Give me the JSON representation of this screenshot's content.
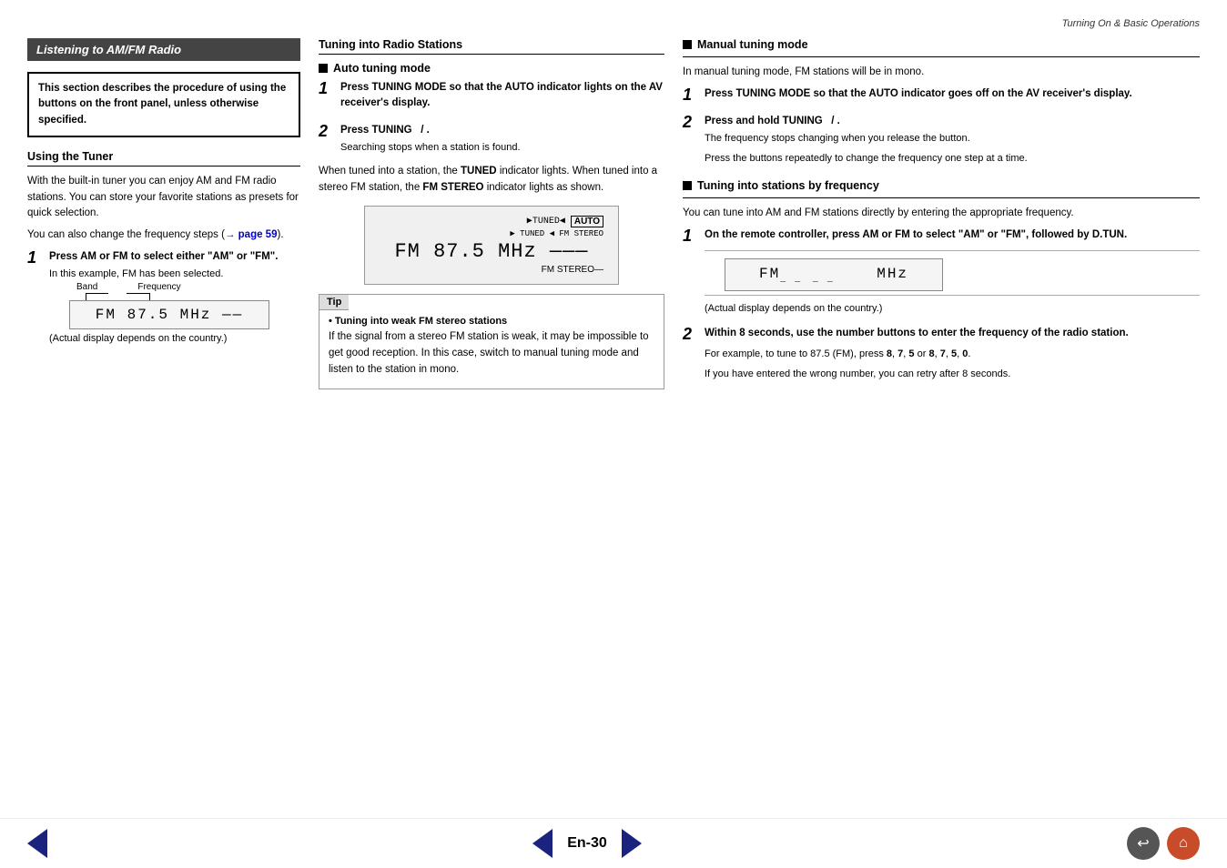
{
  "header": {
    "title": "Turning On & Basic Operations"
  },
  "left_column": {
    "section_title": "Listening to AM/FM Radio",
    "info_box": "This section describes the procedure of using the buttons on the front panel, unless otherwise specified.",
    "tuner_heading": "Using the Tuner",
    "tuner_body1": "With the built-in tuner you can enjoy AM and FM radio stations. You can store your favorite stations as presets for quick selection.",
    "tuner_body2": "You can also change the frequency steps (",
    "tuner_link": "→ page 59",
    "tuner_body2_end": ").",
    "step1_number": "1",
    "step1_title": "Press AM or FM to select either \"AM\" or \"FM\".",
    "step1_desc": "In this example, FM has been selected.",
    "display_band": "Band",
    "display_frequency": "Frequency",
    "display_text": "FM  87.5  MHz  ——",
    "display_caption": "(Actual display depends on the country.)"
  },
  "middle_column": {
    "section_title": "Tuning into Radio Stations",
    "auto_heading": "Auto tuning mode",
    "step1_number": "1",
    "step1_title": "Press TUNING MODE so that the AUTO indicator lights on the AV receiver's display.",
    "step2_number": "2",
    "step2_title": "Press TUNING  / .",
    "step2_desc": "Searching stops when a station is found.",
    "body_text": "When tuned into a station, the TUNED indicator lights. When tuned into a stereo FM station, the FM STEREO indicator lights as shown.",
    "display_tuned": "▶TUNED◀",
    "display_auto": "AUTO",
    "display_small_text": "▶TUNED ◀ FM STEREO",
    "display_freq": "FM  87.5  MHz  ———",
    "display_fm_stereo": "FM STEREO",
    "tip_header": "Tip",
    "tip_bullet": "Tuning into weak FM stereo stations",
    "tip_body": "If the signal from a stereo FM station is weak, it may be impossible to get good reception. In this case, switch to manual tuning mode and listen to the station in mono."
  },
  "right_column": {
    "manual_heading": "Manual tuning mode",
    "manual_body": "In manual tuning mode, FM stations will be in mono.",
    "step1_number": "1",
    "step1_title": "Press TUNING MODE so that the AUTO indicator goes off on the AV receiver's display.",
    "step2_number": "2",
    "step2_title": "Press and hold TUNING  / .",
    "step2_desc1": "The frequency stops changing when you release the button.",
    "step2_desc2": "Press the buttons repeatedly to change the frequency one step at a time.",
    "freq_heading": "Tuning into stations by frequency",
    "freq_body": "You can tune into AM and FM stations directly by entering the appropriate frequency.",
    "freq_step1_number": "1",
    "freq_step1_title": "On the remote controller, press AM or FM to select \"AM\" or \"FM\", followed by D.TUN.",
    "freq_display": "FM__ __  ___  MHz",
    "freq_caption": "(Actual display depends on the country.)",
    "freq_step2_number": "2",
    "freq_step2_title": "Within 8 seconds, use the number buttons to enter the frequency of the radio station.",
    "freq_step2_desc1": "For example, to tune to 87.5 (FM), press 8, 7, 5 or 8, 7, 5, 0.",
    "freq_step2_desc2": "If you have entered the wrong number, you can retry after 8 seconds."
  },
  "bottom": {
    "page_number": "En-30",
    "back_icon": "↩",
    "home_icon": "⌂"
  }
}
